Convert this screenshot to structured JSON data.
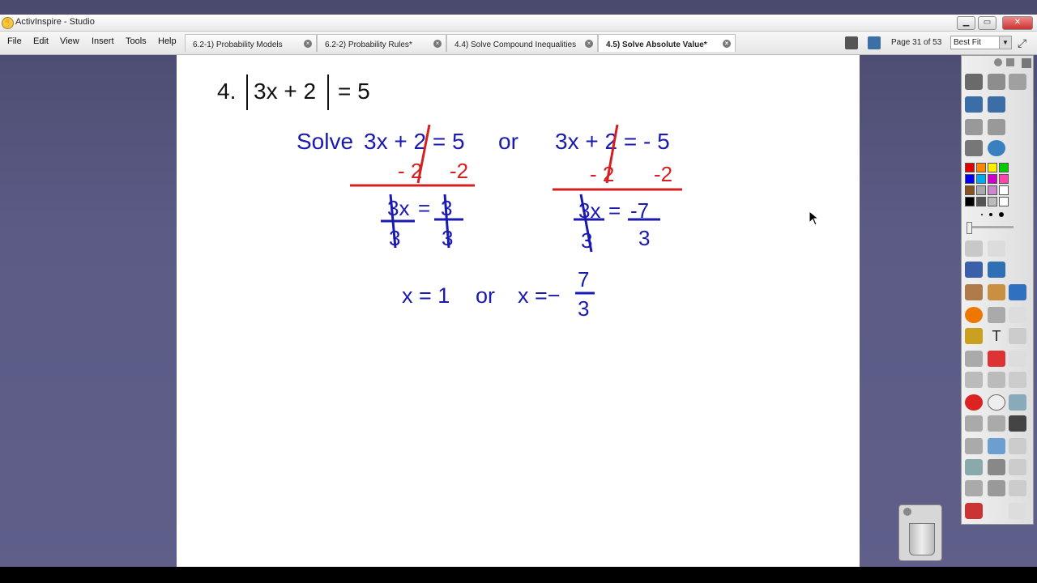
{
  "window": {
    "title": "ActivInspire - Studio"
  },
  "menu": [
    "File",
    "Edit",
    "View",
    "Insert",
    "Tools",
    "Help"
  ],
  "tabs": [
    {
      "label": "6.2-1) Probability Models",
      "active": false
    },
    {
      "label": "6.2-2) Probability Rules*",
      "active": false
    },
    {
      "label": "4.4) Solve Compound Inequalities",
      "active": false
    },
    {
      "label": "4.5) Solve Absolute Value*",
      "active": true
    }
  ],
  "page_indicator": "Page 31 of 53",
  "zoom": "Best Fit",
  "problem": {
    "number": "4.",
    "equation_inner": "3x + 2",
    "equation_rhs": "= 5"
  },
  "work": {
    "solve_word": "Solve",
    "left_eq": "3x + 2 = 5",
    "or_word": "or",
    "right_eq": "3x + 2 = - 5",
    "left_sub_a": "- 2",
    "left_sub_b": "-2",
    "right_sub_a": "- 2",
    "right_sub_b": "-2",
    "left_step_lhs": "3x",
    "left_step_eq": "=",
    "left_step_rhs": "3",
    "left_den_a": "3",
    "left_den_b": "3",
    "right_step_lhs": "3x",
    "right_step_eq": "=",
    "right_step_rhs": "-7",
    "right_den_a": "3",
    "right_den_b": "3",
    "answer_left": "x = 1",
    "answer_or": "or",
    "answer_right": "x =−",
    "answer_num": "7",
    "answer_den": "3"
  },
  "colors": {
    "ink_blue": "#1a1ab0",
    "ink_red": "#d42020",
    "palette": [
      "#e00000",
      "#ff8800",
      "#ffee00",
      "#00cc00",
      "#0000ee",
      "#00aaee",
      "#cc00cc",
      "#ff44aa",
      "#885522",
      "#aaaaaa",
      "#cc88cc",
      "#ffffff",
      "#000000",
      "#555555",
      "#bbbbbb",
      "#ffffff"
    ]
  },
  "icons": {
    "app": "activinspire-icon",
    "pointer": "mouse-cursor-icon",
    "trash": "trash-can-icon"
  }
}
